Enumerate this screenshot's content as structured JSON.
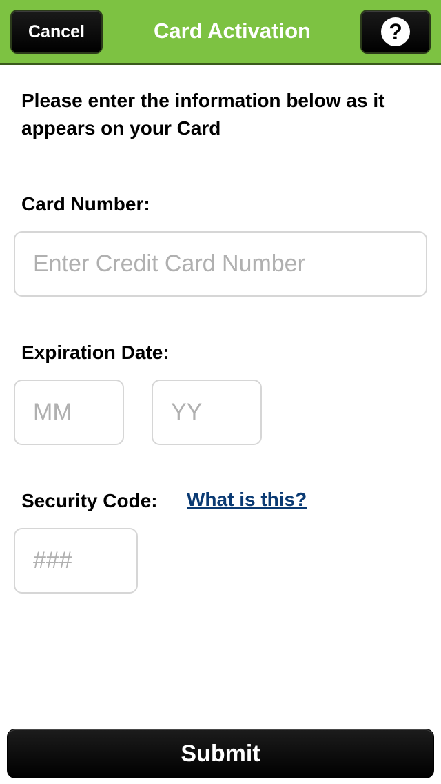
{
  "colors": {
    "navbar": "#7dc242",
    "button": "#000000",
    "link": "#0a3a73",
    "placeholder": "#b0b0b0",
    "field_border": "#d6d6d6"
  },
  "navbar": {
    "cancel_label": "Cancel",
    "title": "Card Activation",
    "help_icon": "question-mark-icon",
    "help_glyph": "?"
  },
  "form": {
    "intro": "Please enter the information below as it appears on your Card",
    "card_number": {
      "label": "Card Number:",
      "placeholder": "Enter Credit Card Number",
      "value": ""
    },
    "expiration": {
      "label": "Expiration Date:",
      "month_placeholder": "MM",
      "year_placeholder": "YY",
      "month_value": "",
      "year_value": ""
    },
    "security_code": {
      "label": "Security Code:",
      "help_link": "What is this?",
      "placeholder": "###",
      "value": ""
    }
  },
  "footer": {
    "submit_label": "Submit"
  }
}
